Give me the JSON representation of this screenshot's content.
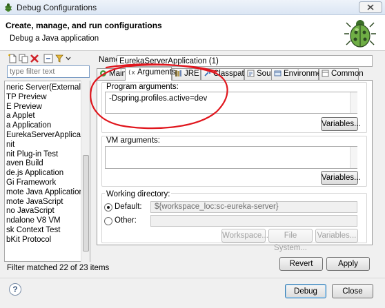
{
  "window": {
    "title": "Debug Configurations",
    "header_title": "Create, manage, and run configurations",
    "header_subtitle": "Debug a Java application"
  },
  "left_pane": {
    "filter_placeholder": "type filter text",
    "tree_items": [
      "neric Server(External Launc",
      "TP Preview",
      "E Preview",
      "a Applet",
      "a Application",
      "EurekaServerApplication (",
      "nit",
      "nit Plug-in Test",
      "aven Build",
      "de.js Application",
      "Gi Framework",
      "mote Java Application",
      "mote JavaScript",
      "no JavaScript",
      "ndalone V8 VM",
      "sk Context Test",
      "bKit Protocol"
    ],
    "status": "Filter matched 22 of 23 items"
  },
  "config": {
    "name_label": "Name:",
    "name_value": "EurekaServerApplication (1)",
    "tabs": [
      "Main",
      "Arguments",
      "JRE",
      "Classpath",
      "Source",
      "Environment",
      "Common"
    ],
    "active_tab": "Arguments",
    "program_args_label": "Program arguments:",
    "program_args_value": "-Dspring.profiles.active=dev",
    "vm_args_label": "VM arguments:",
    "vm_args_value": "",
    "variables_button": "Variables...",
    "working_dir": {
      "label": "Working directory:",
      "default_label": "Default:",
      "default_value": "${workspace_loc:sc-eureka-server}",
      "other_label": "Other:",
      "other_value": "",
      "selected": "Default",
      "workspace_button": "Workspace...",
      "filesystem_button": "File System...",
      "variables_button": "Variables..."
    },
    "revert_button": "Revert",
    "apply_button": "Apply"
  },
  "footer": {
    "help_symbol": "?",
    "debug_button": "Debug",
    "close_button": "Close"
  },
  "colors": {
    "annotation": "#e0161d",
    "window_bg": "#f0f0f0",
    "field_border": "#7a9cc5"
  }
}
